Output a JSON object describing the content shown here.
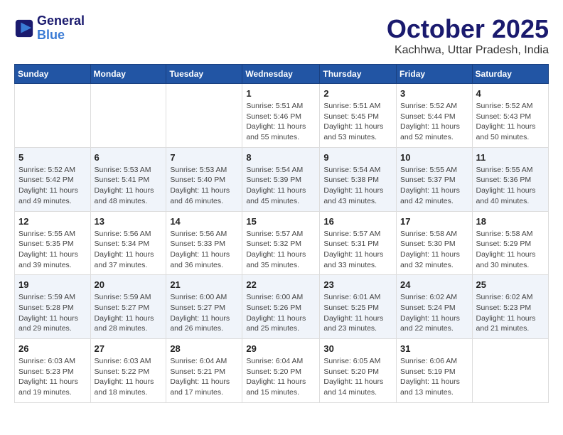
{
  "logo": {
    "line1": "General",
    "line2": "Blue"
  },
  "title": "October 2025",
  "subtitle": "Kachhwa, Uttar Pradesh, India",
  "days_of_week": [
    "Sunday",
    "Monday",
    "Tuesday",
    "Wednesday",
    "Thursday",
    "Friday",
    "Saturday"
  ],
  "weeks": [
    [
      {
        "day": "",
        "detail": ""
      },
      {
        "day": "",
        "detail": ""
      },
      {
        "day": "",
        "detail": ""
      },
      {
        "day": "1",
        "detail": "Sunrise: 5:51 AM\nSunset: 5:46 PM\nDaylight: 11 hours\nand 55 minutes."
      },
      {
        "day": "2",
        "detail": "Sunrise: 5:51 AM\nSunset: 5:45 PM\nDaylight: 11 hours\nand 53 minutes."
      },
      {
        "day": "3",
        "detail": "Sunrise: 5:52 AM\nSunset: 5:44 PM\nDaylight: 11 hours\nand 52 minutes."
      },
      {
        "day": "4",
        "detail": "Sunrise: 5:52 AM\nSunset: 5:43 PM\nDaylight: 11 hours\nand 50 minutes."
      }
    ],
    [
      {
        "day": "5",
        "detail": "Sunrise: 5:52 AM\nSunset: 5:42 PM\nDaylight: 11 hours\nand 49 minutes."
      },
      {
        "day": "6",
        "detail": "Sunrise: 5:53 AM\nSunset: 5:41 PM\nDaylight: 11 hours\nand 48 minutes."
      },
      {
        "day": "7",
        "detail": "Sunrise: 5:53 AM\nSunset: 5:40 PM\nDaylight: 11 hours\nand 46 minutes."
      },
      {
        "day": "8",
        "detail": "Sunrise: 5:54 AM\nSunset: 5:39 PM\nDaylight: 11 hours\nand 45 minutes."
      },
      {
        "day": "9",
        "detail": "Sunrise: 5:54 AM\nSunset: 5:38 PM\nDaylight: 11 hours\nand 43 minutes."
      },
      {
        "day": "10",
        "detail": "Sunrise: 5:55 AM\nSunset: 5:37 PM\nDaylight: 11 hours\nand 42 minutes."
      },
      {
        "day": "11",
        "detail": "Sunrise: 5:55 AM\nSunset: 5:36 PM\nDaylight: 11 hours\nand 40 minutes."
      }
    ],
    [
      {
        "day": "12",
        "detail": "Sunrise: 5:55 AM\nSunset: 5:35 PM\nDaylight: 11 hours\nand 39 minutes."
      },
      {
        "day": "13",
        "detail": "Sunrise: 5:56 AM\nSunset: 5:34 PM\nDaylight: 11 hours\nand 37 minutes."
      },
      {
        "day": "14",
        "detail": "Sunrise: 5:56 AM\nSunset: 5:33 PM\nDaylight: 11 hours\nand 36 minutes."
      },
      {
        "day": "15",
        "detail": "Sunrise: 5:57 AM\nSunset: 5:32 PM\nDaylight: 11 hours\nand 35 minutes."
      },
      {
        "day": "16",
        "detail": "Sunrise: 5:57 AM\nSunset: 5:31 PM\nDaylight: 11 hours\nand 33 minutes."
      },
      {
        "day": "17",
        "detail": "Sunrise: 5:58 AM\nSunset: 5:30 PM\nDaylight: 11 hours\nand 32 minutes."
      },
      {
        "day": "18",
        "detail": "Sunrise: 5:58 AM\nSunset: 5:29 PM\nDaylight: 11 hours\nand 30 minutes."
      }
    ],
    [
      {
        "day": "19",
        "detail": "Sunrise: 5:59 AM\nSunset: 5:28 PM\nDaylight: 11 hours\nand 29 minutes."
      },
      {
        "day": "20",
        "detail": "Sunrise: 5:59 AM\nSunset: 5:27 PM\nDaylight: 11 hours\nand 28 minutes."
      },
      {
        "day": "21",
        "detail": "Sunrise: 6:00 AM\nSunset: 5:27 PM\nDaylight: 11 hours\nand 26 minutes."
      },
      {
        "day": "22",
        "detail": "Sunrise: 6:00 AM\nSunset: 5:26 PM\nDaylight: 11 hours\nand 25 minutes."
      },
      {
        "day": "23",
        "detail": "Sunrise: 6:01 AM\nSunset: 5:25 PM\nDaylight: 11 hours\nand 23 minutes."
      },
      {
        "day": "24",
        "detail": "Sunrise: 6:02 AM\nSunset: 5:24 PM\nDaylight: 11 hours\nand 22 minutes."
      },
      {
        "day": "25",
        "detail": "Sunrise: 6:02 AM\nSunset: 5:23 PM\nDaylight: 11 hours\nand 21 minutes."
      }
    ],
    [
      {
        "day": "26",
        "detail": "Sunrise: 6:03 AM\nSunset: 5:23 PM\nDaylight: 11 hours\nand 19 minutes."
      },
      {
        "day": "27",
        "detail": "Sunrise: 6:03 AM\nSunset: 5:22 PM\nDaylight: 11 hours\nand 18 minutes."
      },
      {
        "day": "28",
        "detail": "Sunrise: 6:04 AM\nSunset: 5:21 PM\nDaylight: 11 hours\nand 17 minutes."
      },
      {
        "day": "29",
        "detail": "Sunrise: 6:04 AM\nSunset: 5:20 PM\nDaylight: 11 hours\nand 15 minutes."
      },
      {
        "day": "30",
        "detail": "Sunrise: 6:05 AM\nSunset: 5:20 PM\nDaylight: 11 hours\nand 14 minutes."
      },
      {
        "day": "31",
        "detail": "Sunrise: 6:06 AM\nSunset: 5:19 PM\nDaylight: 11 hours\nand 13 minutes."
      },
      {
        "day": "",
        "detail": ""
      }
    ]
  ]
}
